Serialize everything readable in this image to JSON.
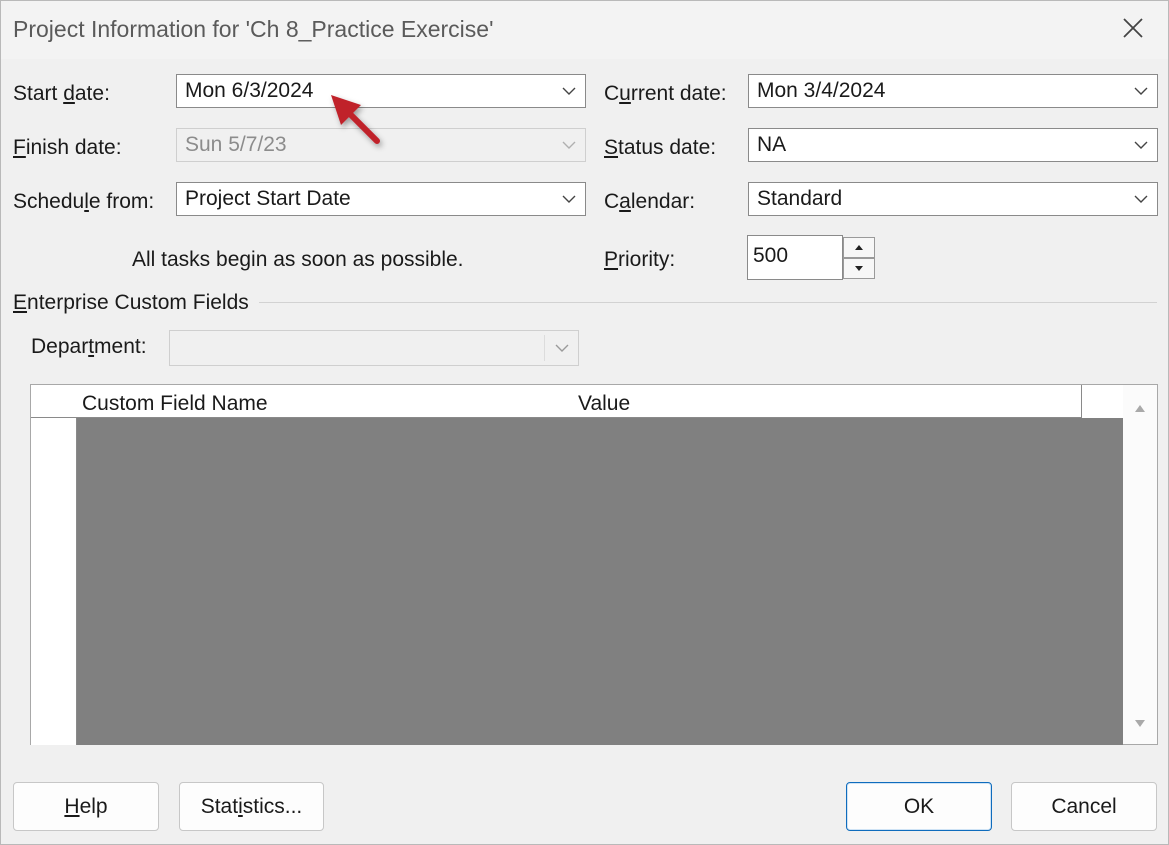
{
  "window": {
    "title": "Project Information for 'Ch 8_Practice Exercise'",
    "close_icon": "close-icon"
  },
  "fields": {
    "start_date": {
      "label": "Start date:",
      "value": "Mon 6/3/2024"
    },
    "finish_date": {
      "label": "Finish date:",
      "value": "Sun 5/7/23"
    },
    "schedule_from": {
      "label": "Schedule from:",
      "value": "Project Start Date"
    },
    "schedule_note": "All tasks begin as soon as possible.",
    "current_date": {
      "label": "Current date:",
      "value": "Mon 3/4/2024"
    },
    "status_date": {
      "label": "Status date:",
      "value": "NA"
    },
    "calendar": {
      "label": "Calendar:",
      "value": "Standard"
    },
    "priority": {
      "label": "Priority:",
      "value": "500"
    }
  },
  "enterprise": {
    "group_label": "Enterprise Custom Fields",
    "department_label": "Department:",
    "department_value": ""
  },
  "grid": {
    "columns": [
      "Custom Field Name",
      "Value"
    ]
  },
  "buttons": {
    "help": "Help",
    "statistics": "Statistics...",
    "ok": "OK",
    "cancel": "Cancel"
  },
  "annotation": {
    "arrow_color": "#c0202a"
  }
}
